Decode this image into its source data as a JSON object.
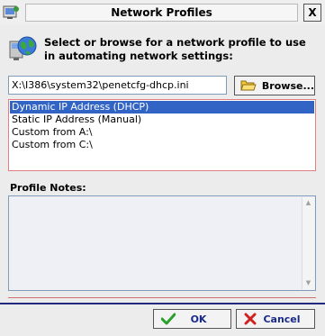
{
  "window": {
    "title": "Network Profiles",
    "close_label": "X"
  },
  "header": {
    "text": "Select or browse for a network profile to use in automating network settings:"
  },
  "path": {
    "value": "X:\\I386\\system32\\penetcfg-dhcp.ini"
  },
  "browse": {
    "label": "Browse..."
  },
  "profiles": {
    "items": [
      "Dynamic IP Address (DHCP)",
      "Static IP Address (Manual)",
      "Custom from A:\\",
      "Custom from C:\\"
    ],
    "selected_index": 0
  },
  "notes": {
    "label": "Profile Notes:",
    "value": ""
  },
  "footer": {
    "ok_label": "OK",
    "cancel_label": "Cancel"
  },
  "icons": {
    "title": "app-icon",
    "header": "network-globe-icon",
    "browse": "folder-open-icon",
    "ok": "check-icon",
    "cancel": "x-icon"
  },
  "colors": {
    "selection": "#3164c4",
    "list_border": "#e08080",
    "navy_separator": "#1f2a80",
    "ok_check": "#2aa02a",
    "cancel_x": "#d02020"
  }
}
